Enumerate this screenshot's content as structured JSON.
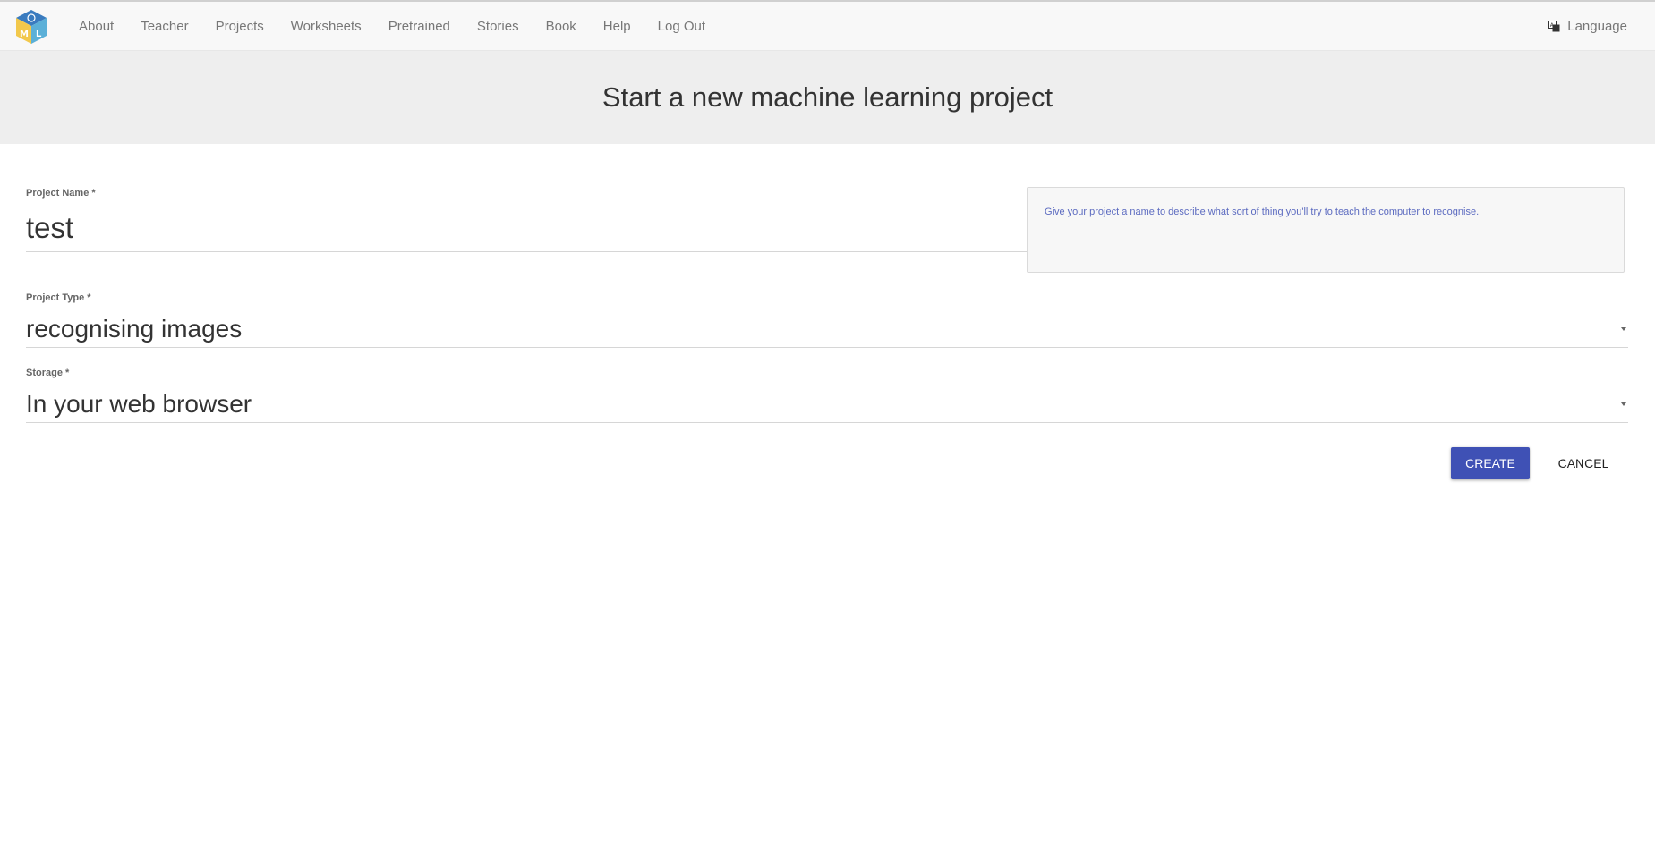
{
  "nav": {
    "logo": "machine-learning-for-kids-logo",
    "items": [
      "About",
      "Teacher",
      "Projects",
      "Worksheets",
      "Pretrained",
      "Stories",
      "Book",
      "Help",
      "Log Out"
    ],
    "language": "Language"
  },
  "page": {
    "title": "Start a new machine learning project"
  },
  "form": {
    "project_name": {
      "label": "Project Name *",
      "value": "test",
      "help": "Give your project a name to describe what sort of thing you'll try to teach the computer to recognise."
    },
    "project_type": {
      "label": "Project Type *",
      "value": "recognising images"
    },
    "storage": {
      "label": "Storage *",
      "value": "In your web browser"
    }
  },
  "buttons": {
    "create": "CREATE",
    "cancel": "CANCEL"
  },
  "colors": {
    "primary": "#3f51b5",
    "help_text": "#5c6bc0"
  }
}
